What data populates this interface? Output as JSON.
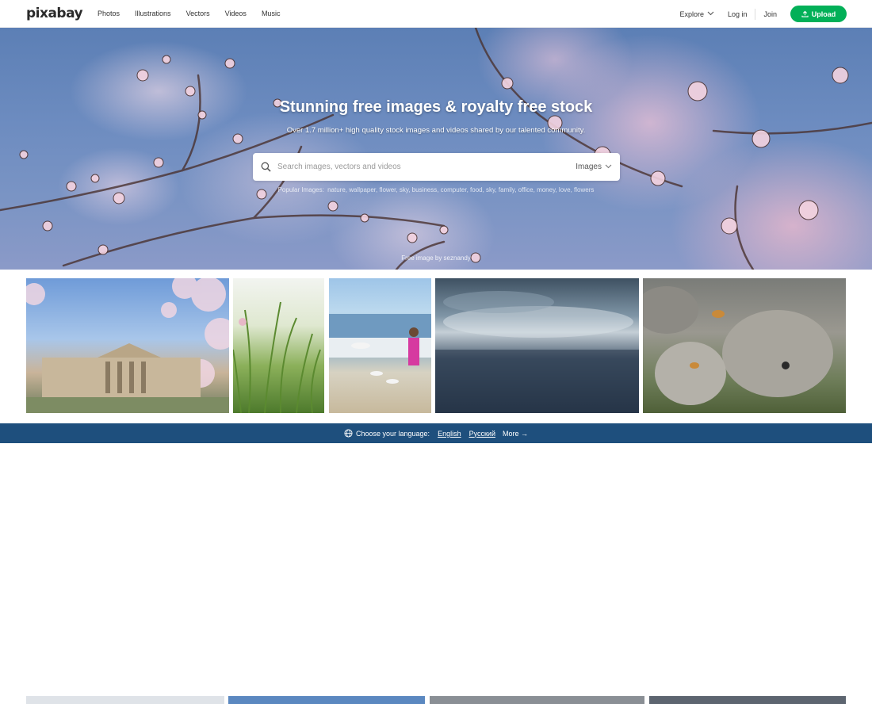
{
  "header": {
    "logo": "pixabay",
    "nav": [
      "Photos",
      "Illustrations",
      "Vectors",
      "Videos",
      "Music"
    ],
    "explore": "Explore",
    "login": "Log in",
    "join": "Join",
    "upload": "Upload",
    "brand_color": "#02b058"
  },
  "hero": {
    "title": "Stunning free images & royalty free stock",
    "subtitle": "Over 1.7 million+ high quality stock images and videos shared by our talented community.",
    "search_placeholder": "Search images, vectors and videos",
    "search_type": "Images",
    "popular_label": "Popular Images:",
    "popular_terms": "nature, wallpaper, flower, sky, business, computer, food, sky, family, office, money, love, flowers",
    "credit": "Free image by seznandy"
  },
  "language_bar": {
    "prompt": "Choose your language:",
    "options": [
      "English",
      "Русский"
    ],
    "more": "More →",
    "background": "#1e4f7d"
  }
}
